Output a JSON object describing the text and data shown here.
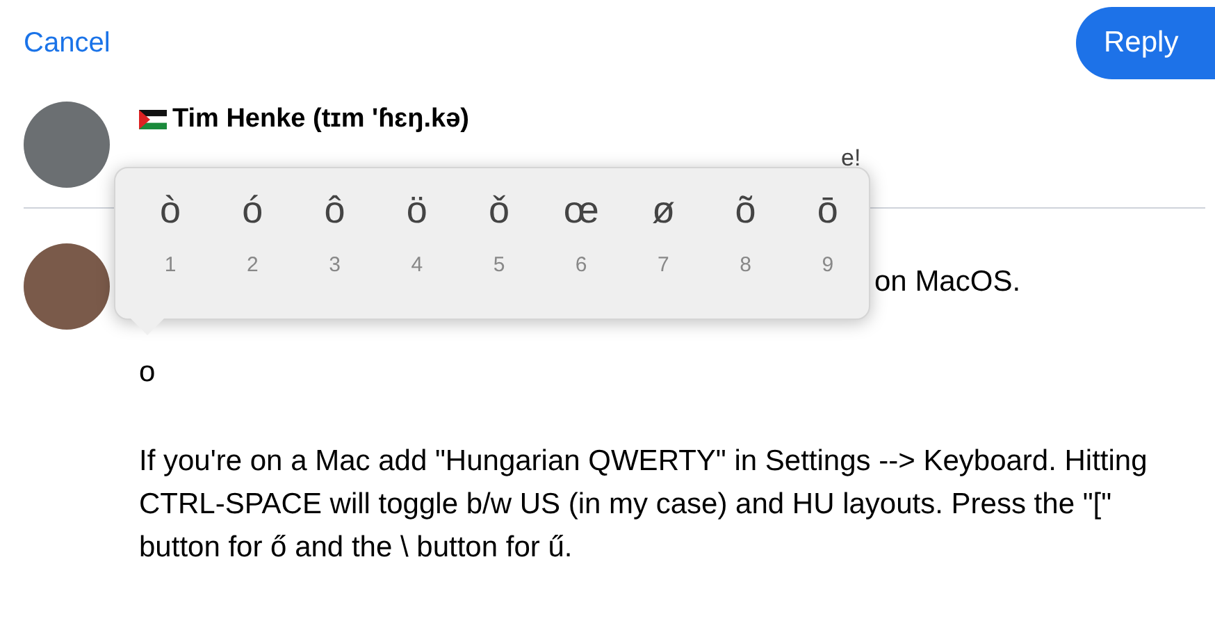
{
  "header": {
    "cancel": "Cancel",
    "reply": "Reply"
  },
  "quoted_post": {
    "author": "Tim Henke (tɪm 'ɦɛŋ.kə)",
    "text_visible_end": "e!"
  },
  "draft": {
    "line_visible_end": "on MacOS.",
    "lines": [
      "o",
      "If you're on a Mac add \"Hungarian QWERTY\" in Settings --> Keyboard. Hitting CTRL-SPACE will toggle b/w US (in my case) and HU layouts. Press the \"[\" button for ő and the \\ button for ű."
    ]
  },
  "accent_popup": [
    {
      "char": "ò",
      "key": "1"
    },
    {
      "char": "ó",
      "key": "2"
    },
    {
      "char": "ô",
      "key": "3"
    },
    {
      "char": "ö",
      "key": "4"
    },
    {
      "char": "ǒ",
      "key": "5"
    },
    {
      "char": "œ",
      "key": "6"
    },
    {
      "char": "ø",
      "key": "7"
    },
    {
      "char": "õ",
      "key": "8"
    },
    {
      "char": "ō",
      "key": "9"
    }
  ]
}
